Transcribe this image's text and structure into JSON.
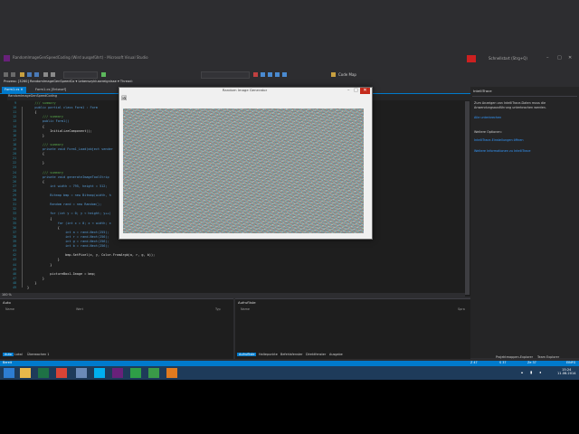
{
  "window": {
    "title": "RandomImageGenSpeedCoding (Wird ausgeführt) - Microsoft Visual Studio",
    "sign_in": "Schnellstart (Strg+Q)",
    "account": "Anmelden"
  },
  "menu": [
    "DATEI",
    "BEARBEITEN",
    "ANSICHT",
    "TEAM",
    "PROJEKT",
    "ERSTELLEN",
    "DEBUGGEN",
    "TEAM",
    "EXTRAS",
    "TEST",
    "ARCHITEKTUR",
    "ANALYSIEREN",
    "FENSTER",
    "HILFE"
  ],
  "toolbar": {
    "codemap": "Code Map"
  },
  "navbar": {
    "text": "Prozess: [3260] RandomImageGenSpeedCo  ▾  Lebenszyklusereignisse ▾  Thread:"
  },
  "tabs": [
    {
      "label": "Form1.cs",
      "active": true
    },
    {
      "label": "Form1.cs [Entwurf]",
      "active": false
    }
  ],
  "editor": {
    "nav_left": "RandomImageGenSpeedCoding",
    "nav_right": "Form1Child(object sender, EventArgs e)",
    "zoom": "100 %",
    "lines": [
      {
        "n": "9",
        "text": "    /// summary"
      },
      {
        "n": "10",
        "text": "    public partial class Form1 : Form"
      },
      {
        "n": "11",
        "text": "    {"
      },
      {
        "n": "12",
        "text": "        /// summary"
      },
      {
        "n": "13",
        "text": "        public Form1()"
      },
      {
        "n": "14",
        "text": "        {"
      },
      {
        "n": "15",
        "text": "            InitializeComponent();"
      },
      {
        "n": "16",
        "text": "        }"
      },
      {
        "n": "17",
        "text": ""
      },
      {
        "n": "18",
        "text": "        /// summary"
      },
      {
        "n": "19",
        "text": "        private void Form1_Load(object sender"
      },
      {
        "n": "20",
        "text": "        {"
      },
      {
        "n": "21",
        "text": ""
      },
      {
        "n": "22",
        "text": "        }"
      },
      {
        "n": "23",
        "text": ""
      },
      {
        "n": "24",
        "text": "        /// summary"
      },
      {
        "n": "25",
        "text": "        private void generateImageToolStrip"
      },
      {
        "n": "26",
        "text": "        {"
      },
      {
        "n": "27",
        "text": "            int width = 795, height = 512;"
      },
      {
        "n": "28",
        "text": ""
      },
      {
        "n": "29",
        "text": "            Bitmap bmp = new Bitmap(width, h"
      },
      {
        "n": "30",
        "text": ""
      },
      {
        "n": "31",
        "text": "            Random rand = new Random();"
      },
      {
        "n": "32",
        "text": ""
      },
      {
        "n": "33",
        "text": "            for (int y = 0; y < height; y++)"
      },
      {
        "n": "34",
        "text": "            {"
      },
      {
        "n": "35",
        "text": "                for (int x = 0; x < width; x"
      },
      {
        "n": "36",
        "text": "                {"
      },
      {
        "n": "37",
        "text": "                    int a = rand.Next(255);"
      },
      {
        "n": "38",
        "text": "                    int r = rand.Next(256);"
      },
      {
        "n": "39",
        "text": "                    int g = rand.Next(256);"
      },
      {
        "n": "40",
        "text": "                    int b = rand.Next(256);"
      },
      {
        "n": "41",
        "text": ""
      },
      {
        "n": "42",
        "text": "                    bmp.SetPixel(x, y, Color.FromArgb(a, r, g, b));"
      },
      {
        "n": "43",
        "text": "                }"
      },
      {
        "n": "44",
        "text": "            }"
      },
      {
        "n": "45",
        "text": ""
      },
      {
        "n": "46",
        "text": "            pictureBox1.Image = bmp;"
      },
      {
        "n": "47",
        "text": "        }"
      },
      {
        "n": "48",
        "text": "    }"
      },
      {
        "n": "49",
        "text": "}"
      }
    ]
  },
  "dialog": {
    "title": "Random Image Generator"
  },
  "right_panel": {
    "title": "IntelliTrace",
    "lines": [
      {
        "text": "Zum Anzeigen von IntelliTrace-Daten muss die",
        "color": "#cccccc"
      },
      {
        "text": "Anwendungsausführung unterbrochen werden.",
        "color": "#cccccc"
      },
      {
        "text": "Alle unterbrechen",
        "color": "#3399ff"
      },
      {
        "text": "Weitere Optionen:",
        "color": "#cccccc"
      },
      {
        "text": "IntelliTrace-Einstellungen öffnen",
        "color": "#3399ff"
      },
      {
        "text": "Weitere Informationen zu IntelliTrace",
        "color": "#3399ff"
      }
    ]
  },
  "bottom_left": {
    "title": "Auto",
    "columns": [
      "Name",
      "Wert",
      "Typ"
    ],
    "tabs": [
      "Auto",
      "Lokal",
      "Überwachen 1"
    ]
  },
  "bottom_right": {
    "title": "Aufrufliste",
    "columns": [
      "Name",
      "Spra"
    ],
    "tabs": [
      "Aufrufliste",
      "Haltepunkte",
      "Befehlsfenster",
      "Direktfenster",
      "Ausgabe"
    ]
  },
  "statusbar": {
    "left": "Bereit",
    "z": "Z 47",
    "s": "S 37",
    "ch": "Ze 37",
    "ins": "EINFG",
    "projmappe": "Projektmappen-Explorer",
    "team": "Team Explorer"
  },
  "taskbar": {
    "time": "15:24",
    "date": "11.06.2014",
    "icons": [
      {
        "name": "windows-icon",
        "color": "#2d7dd2"
      },
      {
        "name": "explorer-icon",
        "color": "#e8b84a"
      },
      {
        "name": "excel-icon",
        "color": "#1e7145"
      },
      {
        "name": "chrome-icon",
        "color": "#d94436"
      },
      {
        "name": "network-icon",
        "color": "#6a8ab8"
      },
      {
        "name": "skype-icon",
        "color": "#00aff0"
      },
      {
        "name": "visualstudio-icon",
        "color": "#68217a"
      },
      {
        "name": "camtasia-icon",
        "color": "#2e9e47"
      },
      {
        "name": "camtasia2-icon",
        "color": "#3a9a48"
      },
      {
        "name": "app-icon",
        "color": "#e07a1f"
      }
    ]
  }
}
